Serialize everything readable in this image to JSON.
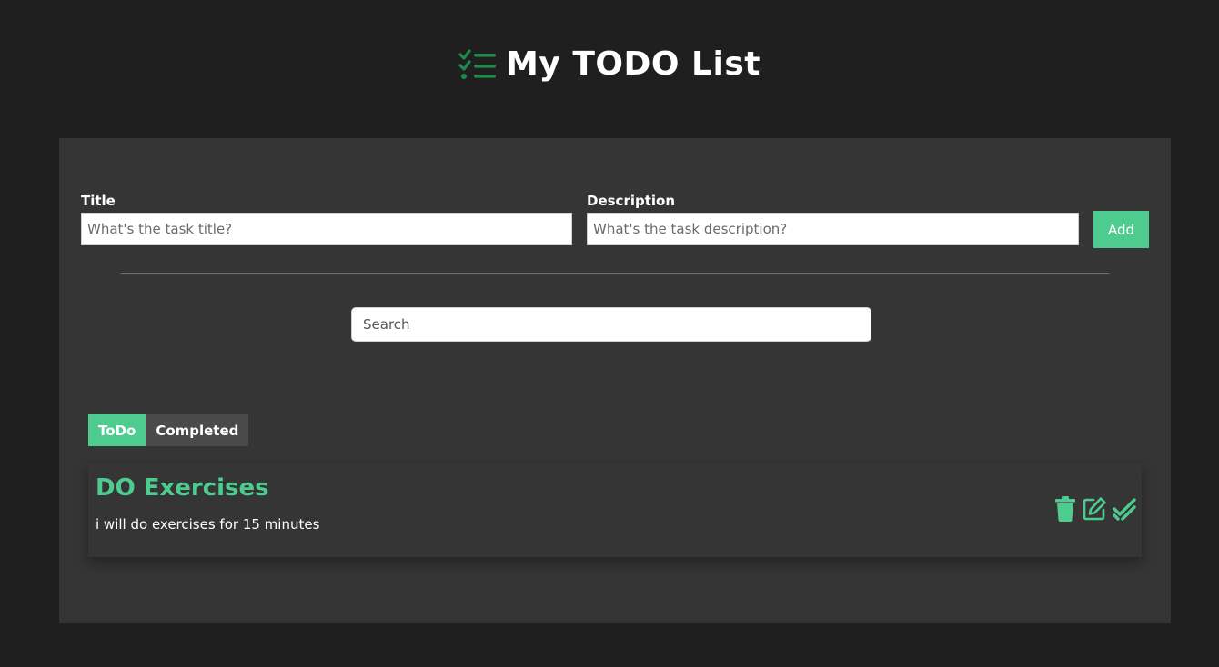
{
  "header": {
    "title": "My TODO List",
    "logo_icon": "list-check-icon"
  },
  "form": {
    "title_label": "Title",
    "title_placeholder": "What's the task title?",
    "title_value": "",
    "description_label": "Description",
    "description_placeholder": "What's the task description?",
    "description_value": "",
    "add_label": "Add"
  },
  "search": {
    "placeholder": "Search",
    "value": ""
  },
  "tabs": [
    {
      "label": "ToDo",
      "active": true
    },
    {
      "label": "Completed",
      "active": false
    }
  ],
  "tasks": [
    {
      "title": "DO Exercises",
      "description": "i will do exercises for 15 minutes",
      "actions": [
        "trash-icon",
        "edit-icon",
        "check-icon"
      ]
    }
  ],
  "colors": {
    "accent": "#4ecb8f",
    "logo": "#1f8a4c",
    "background": "#1f1f1f",
    "panel": "#353535"
  }
}
